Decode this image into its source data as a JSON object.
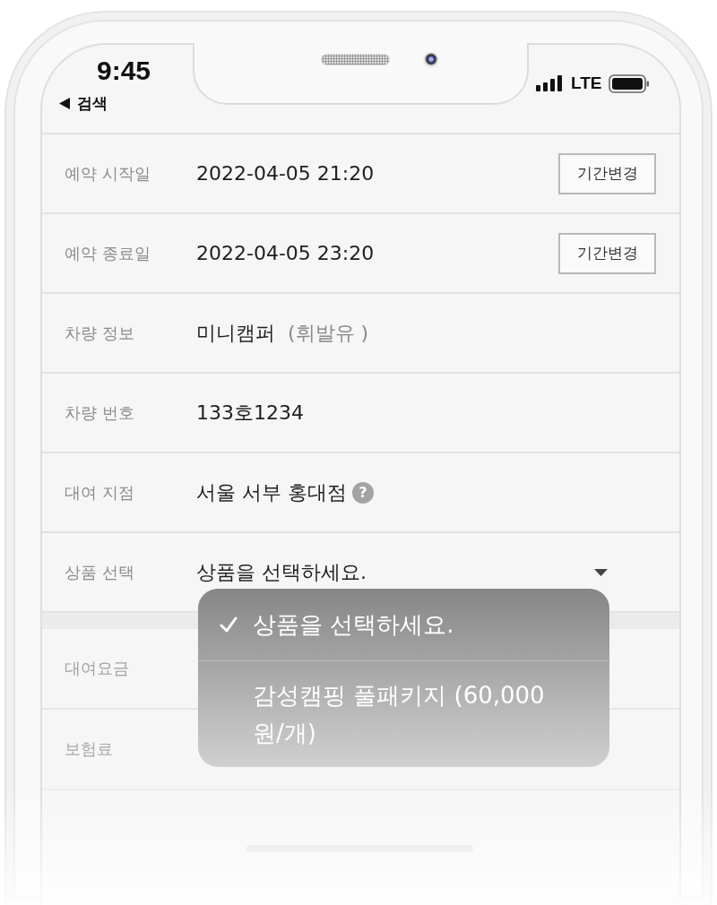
{
  "status_bar": {
    "time": "9:45",
    "back_label": "검색",
    "network": "LTE"
  },
  "details": [
    {
      "kind": "button",
      "label": "예약 시작일",
      "value": "2022-04-05 21:20",
      "action": "기간변경"
    },
    {
      "kind": "button",
      "label": "예약 종료일",
      "value": "2022-04-05 23:20",
      "action": "기간변경"
    },
    {
      "kind": "note",
      "label": "차량 정보",
      "value": "미니캠퍼",
      "note": "(휘발유 )"
    },
    {
      "kind": "text",
      "label": "차량 번호",
      "value": "133호1234"
    },
    {
      "kind": "help",
      "label": "대여 지점",
      "value": "서울 서부 홍대점",
      "help": "?"
    },
    {
      "kind": "select",
      "label": "상품 선택",
      "value": "상품을 선택하세요."
    }
  ],
  "product_menu": {
    "options": [
      {
        "label": "상품을 선택하세요.",
        "selected": true
      },
      {
        "label": "감성캠핑 풀패키지 (60,000 원/개)",
        "selected": false
      }
    ]
  },
  "charges": [
    {
      "label": "대여요금"
    },
    {
      "label": "보험료"
    }
  ]
}
